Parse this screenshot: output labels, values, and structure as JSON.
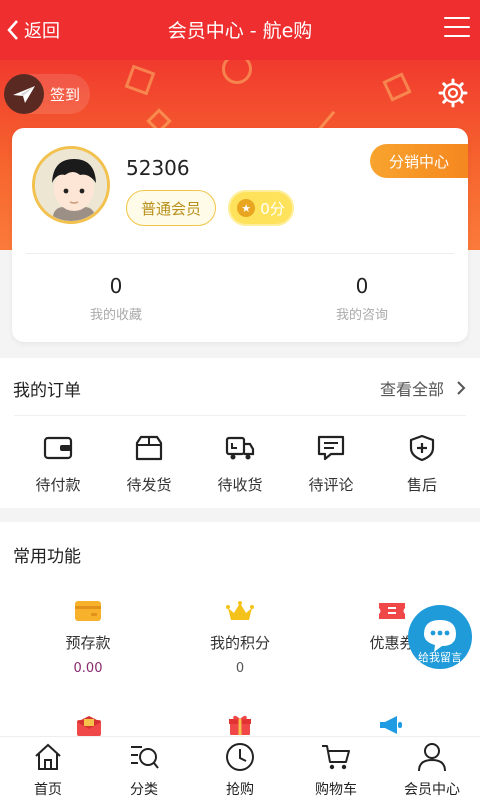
{
  "header": {
    "back_label": "返回",
    "title": "会员中心 - 航e购"
  },
  "hero": {
    "checkin_label": "签到"
  },
  "profile": {
    "username": "52306",
    "level_badge": "普通会员",
    "points_badge": "0分",
    "distribution_button": "分销中心",
    "stats": [
      {
        "value": "0",
        "label": "我的收藏"
      },
      {
        "value": "0",
        "label": "我的咨询"
      }
    ]
  },
  "orders": {
    "title": "我的订单",
    "view_all": "查看全部",
    "items": [
      {
        "label": "待付款",
        "icon": "wallet-icon"
      },
      {
        "label": "待发货",
        "icon": "package-icon"
      },
      {
        "label": "待收货",
        "icon": "truck-icon"
      },
      {
        "label": "待评论",
        "icon": "comment-icon"
      },
      {
        "label": "售后",
        "icon": "shield-plus-icon"
      }
    ]
  },
  "functions": {
    "title": "常用功能",
    "items": [
      {
        "label": "预存款",
        "value": "0.00",
        "icon": "card-icon"
      },
      {
        "label": "我的积分",
        "value": "0",
        "icon": "crown-icon"
      },
      {
        "label": "优惠券",
        "value": "",
        "icon": "coupon-icon"
      }
    ]
  },
  "chat_widget": {
    "label": "给我留言"
  },
  "bottom_nav": {
    "items": [
      {
        "label": "首页",
        "icon": "home-icon"
      },
      {
        "label": "分类",
        "icon": "category-search-icon"
      },
      {
        "label": "抢购",
        "icon": "clock-icon"
      },
      {
        "label": "购物车",
        "icon": "cart-icon"
      },
      {
        "label": "会员中心",
        "icon": "user-icon"
      }
    ]
  },
  "colors": {
    "brand_red": "#ef2f2f",
    "orange": "#f6652e",
    "gold": "#f0c64a",
    "purple_value": "#8a2a6f"
  }
}
